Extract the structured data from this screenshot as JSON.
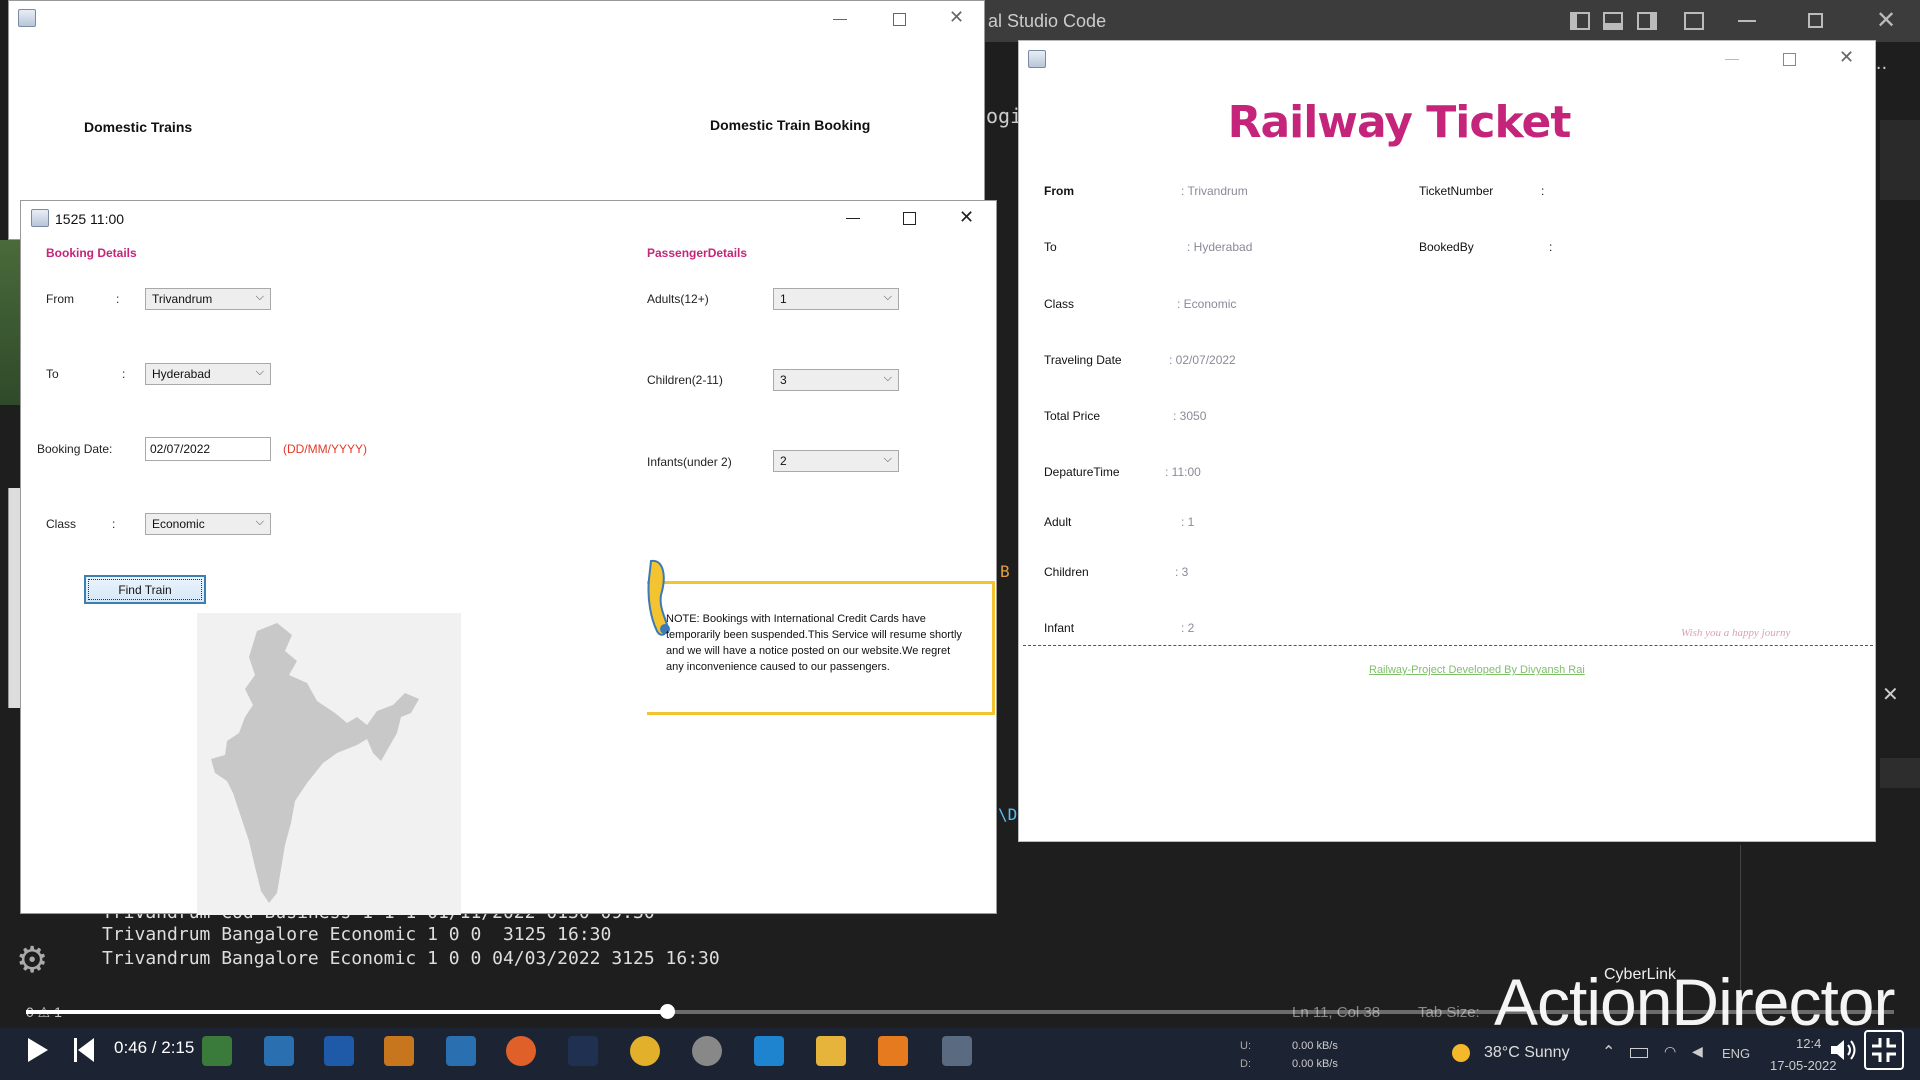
{
  "vscode": {
    "title_fragment": "al Studio Code",
    "side_text_1": "ogi",
    "side_text_2": "B",
    "side_text_3": "\\D",
    "terminal_lines": [
      "Trivandrum Cod Business 1 1 1 01/11/2022 0130 09:30",
      "Trivandrum Bangalore Economic 1 0 0  3125 16:30",
      "Trivandrum Bangalore Economic 1 0 0 04/03/2022 3125 16:30"
    ],
    "status_left": "0 ⚠ 1",
    "status_right_1": "Ln 11, Col 38",
    "status_right_2": "Tab Size:"
  },
  "main_window": {
    "left_title": "Domestic Trains",
    "right_title": "Domestic Train Booking"
  },
  "booking_window": {
    "title": "1525 11:00",
    "booking_header": "Booking Details",
    "passenger_header": "PassengerDetails",
    "from_label": "From",
    "from_colon": ":",
    "from_value": "Trivandrum",
    "to_label": "To",
    "to_colon": ":",
    "to_value": "Hyderabad",
    "date_label": "Booking Date:",
    "date_value": "02/07/2022",
    "date_hint": "(DD/MM/YYYY)",
    "class_label": "Class",
    "class_colon": ":",
    "class_value": "Economic",
    "find_button": "Find Train",
    "adults_label": "Adults(12+)",
    "adults_value": "1",
    "children_label": "Children(2-11)",
    "children_value": "3",
    "infants_label": "Infants(under 2)",
    "infants_value": "2",
    "note": "NOTE: Bookings with International Credit Cards have temporarily been suspended.This Service will resume shortly and we will have a notice posted on our website.We regret any inconvenience caused to our passengers."
  },
  "ticket_window": {
    "title": "Railway Ticket",
    "rows": [
      {
        "label": "From",
        "value": ": Trivandrum"
      },
      {
        "label": "To",
        "value": ": Hyderabad"
      },
      {
        "label": "Class",
        "value": ": Economic"
      },
      {
        "label": "Traveling Date",
        "value": ": 02/07/2022"
      },
      {
        "label": "Total Price",
        "value": ": 3050"
      },
      {
        "label": "DepatureTime",
        "value": ": 11:00"
      },
      {
        "label": "Adult",
        "value": ": 1"
      },
      {
        "label": "Children",
        "value": ": 3"
      },
      {
        "label": "Infant",
        "value": ": 2"
      }
    ],
    "ticket_number_label": "TicketNumber",
    "ticket_number_value": ":",
    "booked_by_label": "BookedBy",
    "booked_by_value": ":",
    "wish": "Wish you a happy journy",
    "footer_link": "Railway-Project Developed By Divyansh Rai"
  },
  "player": {
    "time": "0:46 / 2:15",
    "progress": 0.343,
    "brand_small": "CyberLink",
    "brand_big": "ActionDirector"
  },
  "taskbar": {
    "net_up": "0.00 kB/s",
    "net_down": "0.00 kB/s",
    "net_u_label": "U:",
    "net_d_label": "D:",
    "weather": "38°C Sunny",
    "lang": "ENG",
    "time": "12:4",
    "date": "17-05-2022"
  },
  "colors": {
    "accent_pink": "#c4257a",
    "note_border": "#f4c430",
    "progress": "#ffffff",
    "vscode_bg": "#1e1e1e"
  }
}
